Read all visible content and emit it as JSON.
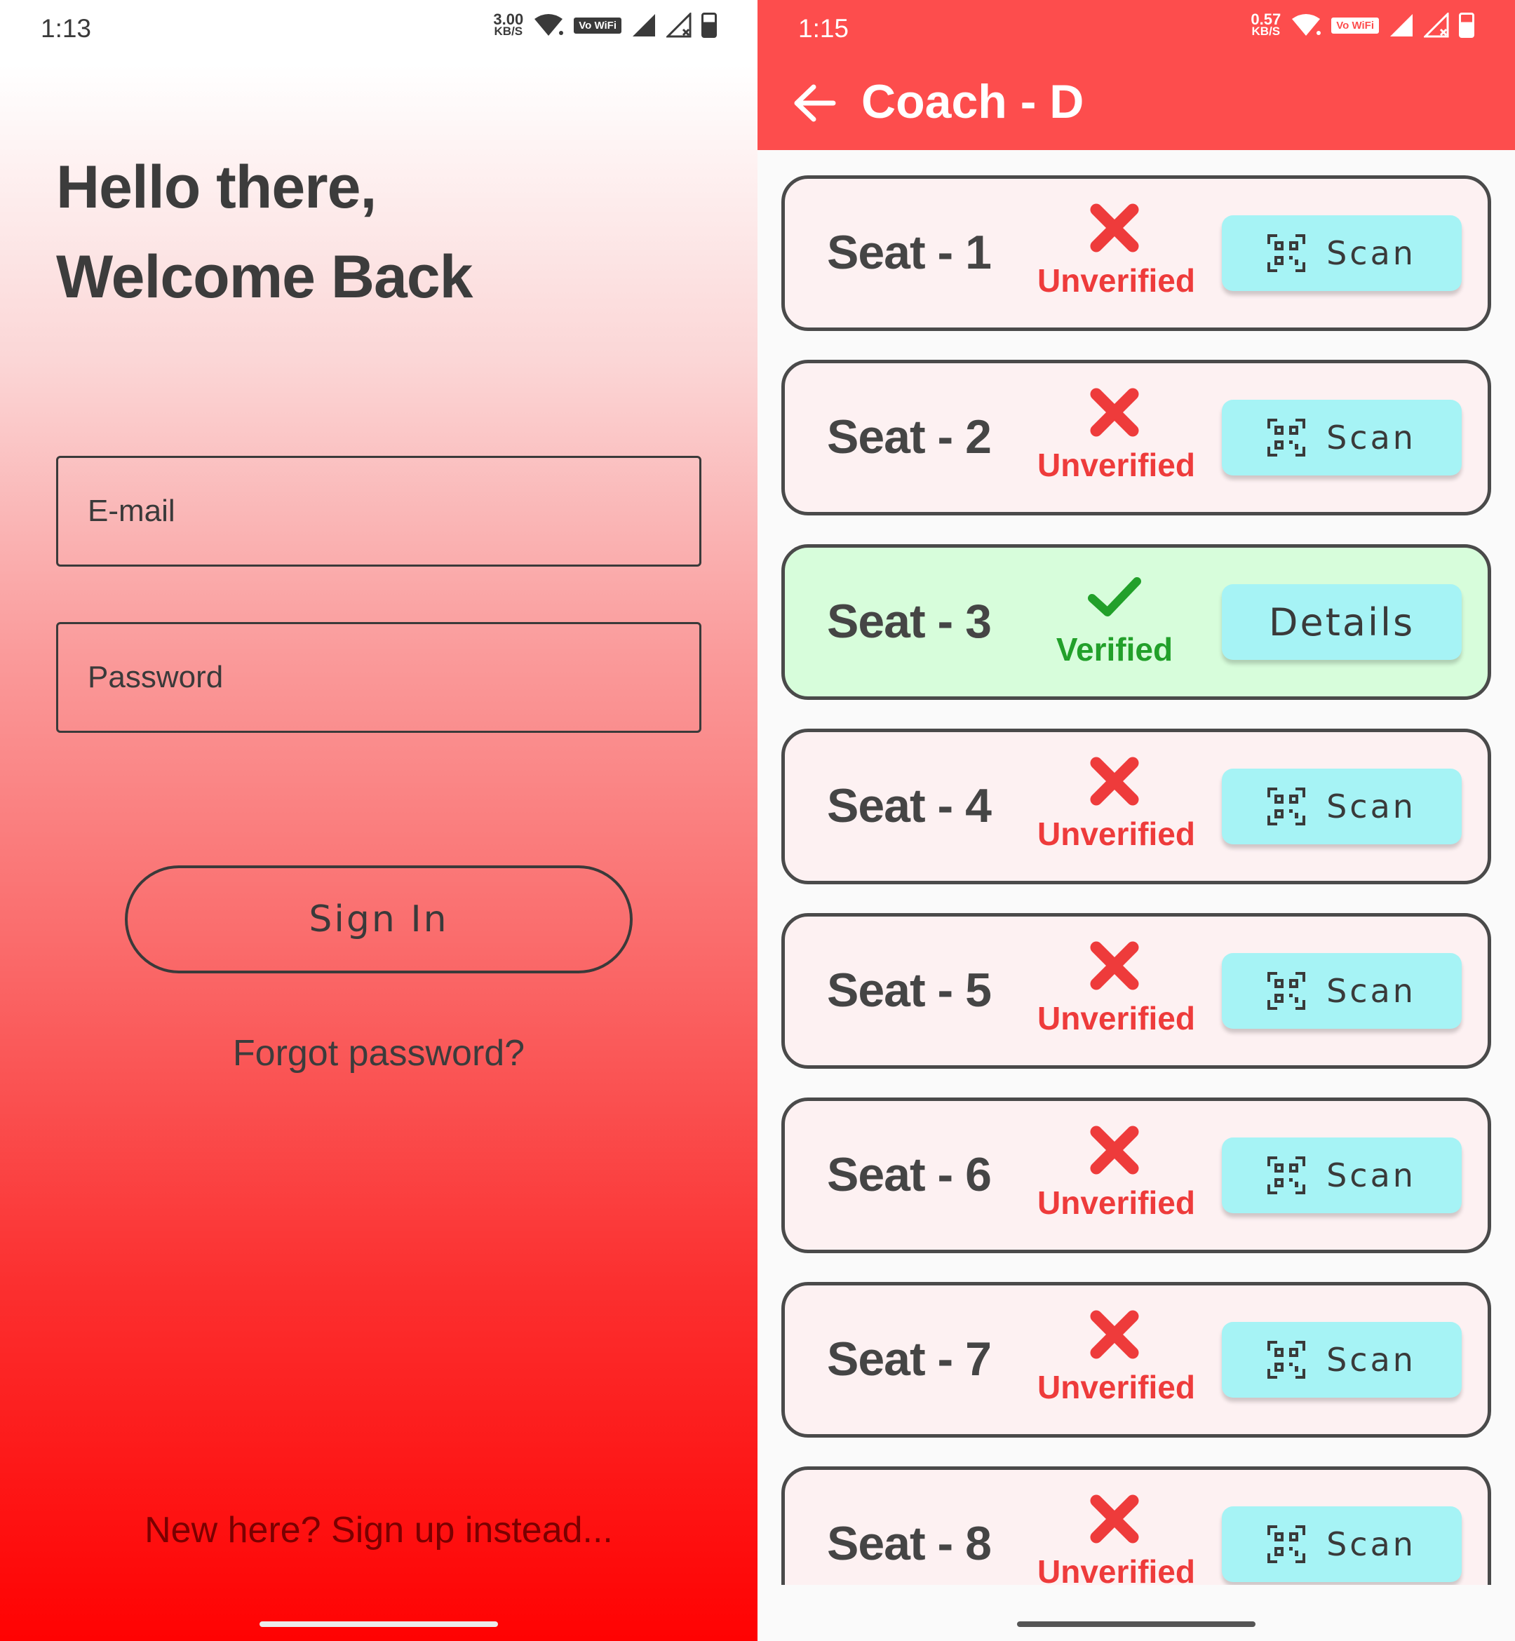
{
  "login": {
    "status": {
      "time": "1:13",
      "speed": "3.00",
      "speed_unit": "KB/S",
      "vowifi": "Vo WiFi"
    },
    "greeting_line1": "Hello there,",
    "greeting_line2": "Welcome Back",
    "email_placeholder": "E-mail",
    "password_placeholder": "Password",
    "signin_label": "Sign In",
    "forgot_label": "Forgot password?",
    "signup_label": "New here? Sign up instead..."
  },
  "coach": {
    "status": {
      "time": "1:15",
      "speed": "0.57",
      "speed_unit": "KB/S",
      "vowifi": "Vo WiFi"
    },
    "title": "Coach - D",
    "seats": [
      {
        "label": "Seat - 1",
        "status": "Unverified",
        "action": "Scan"
      },
      {
        "label": "Seat - 2",
        "status": "Unverified",
        "action": "Scan"
      },
      {
        "label": "Seat - 3",
        "status": "Verified",
        "action": "Details"
      },
      {
        "label": "Seat - 4",
        "status": "Unverified",
        "action": "Scan"
      },
      {
        "label": "Seat - 5",
        "status": "Unverified",
        "action": "Scan"
      },
      {
        "label": "Seat - 6",
        "status": "Unverified",
        "action": "Scan"
      },
      {
        "label": "Seat - 7",
        "status": "Unverified",
        "action": "Scan"
      },
      {
        "label": "Seat - 8",
        "status": "Unverified",
        "action": "Scan"
      }
    ]
  },
  "colors": {
    "appbar": "#fd4d4d",
    "unverified": "#ee3b3b",
    "verified": "#22a02a",
    "button": "#a6f3f5",
    "card_unverified_bg": "#fdf1f2",
    "card_verified_bg": "#d7fddb"
  }
}
